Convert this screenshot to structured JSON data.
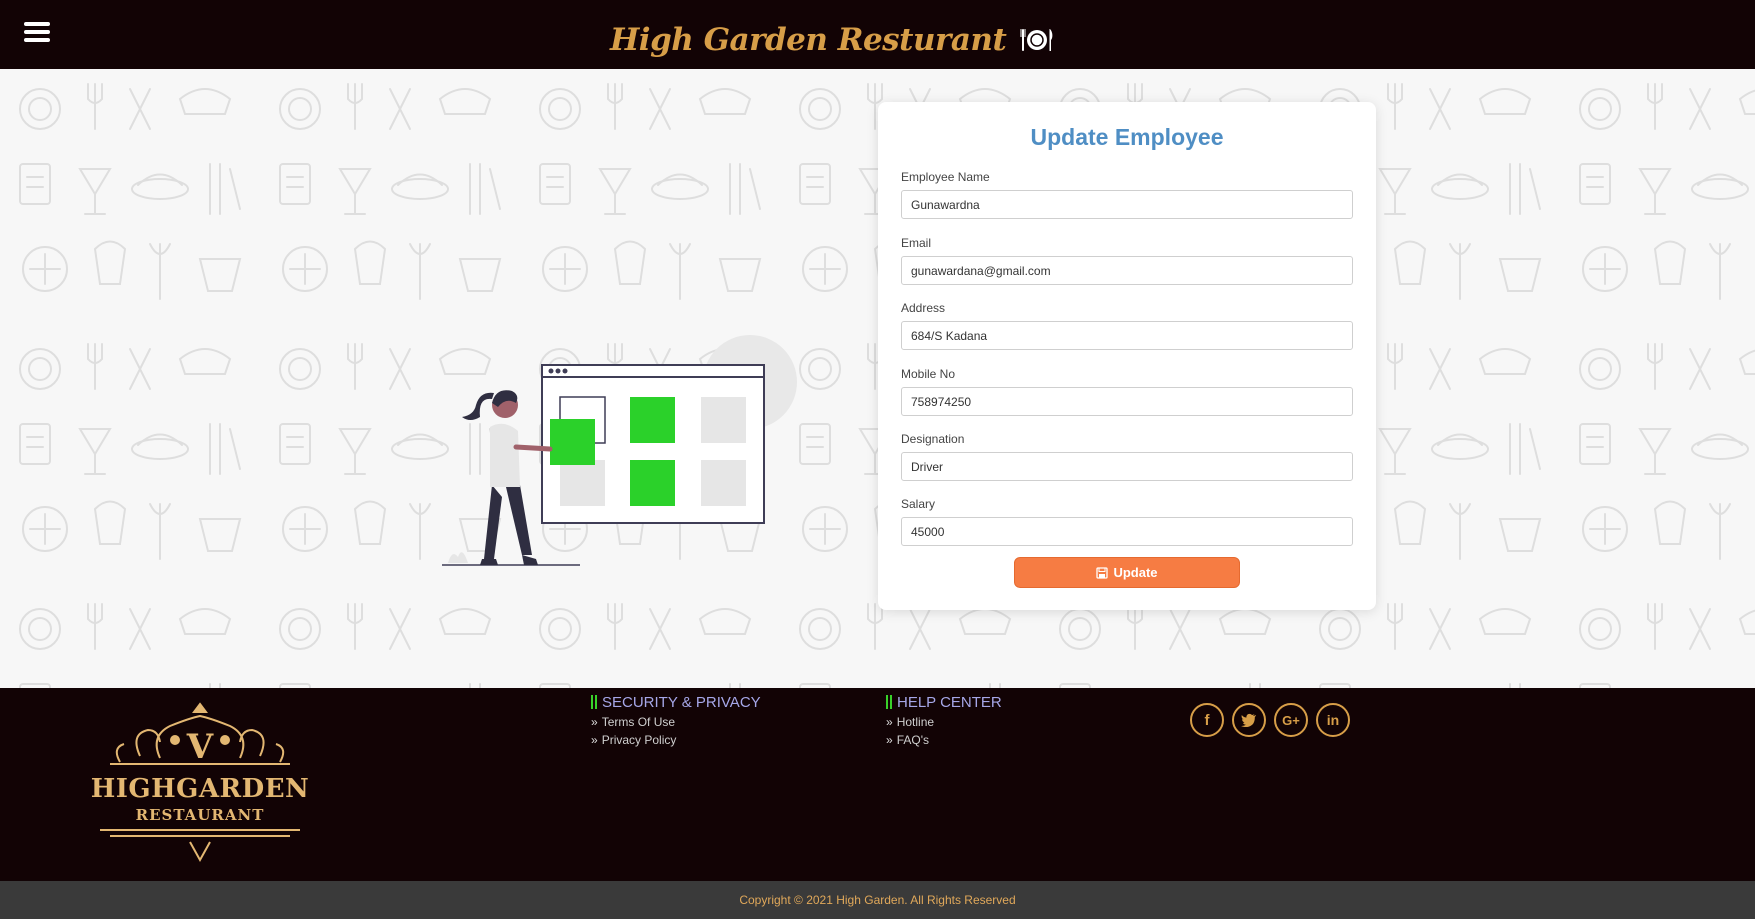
{
  "header": {
    "title": "High Garden Resturant",
    "menu_icon": "hamburger-menu-icon",
    "brand_icon": "plate-cutlery-icon"
  },
  "form": {
    "title": "Update Employee",
    "fields": [
      {
        "label": "Employee Name",
        "value": "Gunawardna"
      },
      {
        "label": "Email",
        "value": "gunawardana@gmail.com"
      },
      {
        "label": "Address",
        "value": "684/S Kadana"
      },
      {
        "label": "Mobile No",
        "value": "758974250"
      },
      {
        "label": "Designation",
        "value": "Driver"
      },
      {
        "label": "Salary",
        "value": "45000"
      }
    ],
    "submit_label": "Update",
    "submit_icon": "save-icon"
  },
  "footer": {
    "logo": {
      "monogram": "V",
      "name": "HIGHGARDEN",
      "subtitle": "RESTAURANT"
    },
    "security": {
      "title": "SECURITY & PRIVACY",
      "links": [
        "Terms Of Use",
        "Privacy Policy"
      ]
    },
    "help": {
      "title": "HELP CENTER",
      "links": [
        "Hotline",
        "FAQ's"
      ]
    },
    "social": [
      {
        "name": "facebook-icon",
        "glyph": "f"
      },
      {
        "name": "twitter-icon",
        "glyph": "t"
      },
      {
        "name": "google-plus-icon",
        "glyph": "G+"
      },
      {
        "name": "linkedin-icon",
        "glyph": "in"
      }
    ],
    "copyright": "Copyright © 2021 High Garden. All Rights Reserved"
  },
  "colors": {
    "header_bg": "#120305",
    "brand_gold": "#d79e48",
    "title_blue": "#4f8ec4",
    "button_orange": "#f67c43",
    "accent_green": "#39d12a",
    "footer_heading": "#a6a7e8"
  }
}
